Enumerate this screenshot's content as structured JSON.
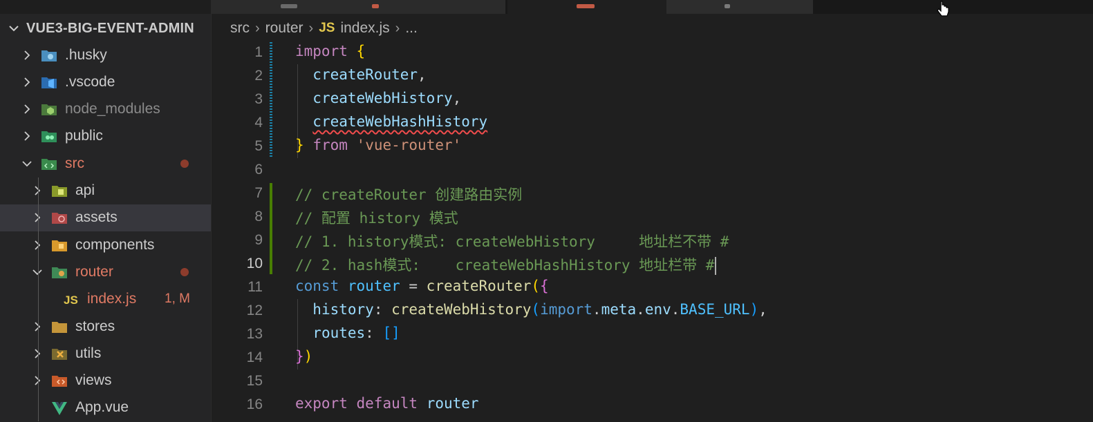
{
  "explorer": {
    "root_label": "VUE3-BIG-EVENT-ADMIN",
    "items": [
      {
        "label": ".husky",
        "icon": "husky-folder-icon",
        "expanded": false,
        "color": "#cccccc"
      },
      {
        "label": ".vscode",
        "icon": "vscode-folder-icon",
        "expanded": false,
        "color": "#cccccc"
      },
      {
        "label": "node_modules",
        "icon": "node-folder-icon",
        "expanded": false,
        "color": "#8b8b8b"
      },
      {
        "label": "public",
        "icon": "public-folder-icon",
        "expanded": false,
        "color": "#cccccc"
      },
      {
        "label": "src",
        "icon": "src-folder-icon",
        "expanded": true,
        "color": "#e07a64",
        "modified": true
      },
      {
        "label": "api",
        "icon": "api-folder-icon",
        "expanded": false,
        "color": "#cccccc"
      },
      {
        "label": "assets",
        "icon": "assets-folder-icon",
        "expanded": false,
        "color": "#cccccc",
        "selected": true
      },
      {
        "label": "components",
        "icon": "components-folder-icon",
        "expanded": false,
        "color": "#cccccc"
      },
      {
        "label": "router",
        "icon": "router-folder-icon",
        "expanded": true,
        "color": "#e07a64",
        "modified": true
      },
      {
        "label": "index.js",
        "icon": "js-file-icon",
        "file": true,
        "color": "#e07a64",
        "status": "1, M"
      },
      {
        "label": "stores",
        "icon": "stores-folder-icon",
        "expanded": false,
        "color": "#cccccc"
      },
      {
        "label": "utils",
        "icon": "utils-folder-icon",
        "expanded": false,
        "color": "#cccccc"
      },
      {
        "label": "views",
        "icon": "views-folder-icon",
        "expanded": false,
        "color": "#cccccc"
      },
      {
        "label": "App.vue",
        "icon": "vue-file-icon",
        "file": true,
        "color": "#cccccc"
      }
    ]
  },
  "breadcrumbs": {
    "parts": [
      "src",
      "router"
    ],
    "file_badge": "JS",
    "file_name": "index.js",
    "ellipsis": "..."
  },
  "editor": {
    "active_line": 10,
    "lines": [
      {
        "n": "1",
        "tokens": [
          [
            "k",
            "import"
          ],
          [
            "p",
            " "
          ],
          [
            "b1",
            "{"
          ]
        ]
      },
      {
        "n": "2",
        "tokens": [
          [
            "p",
            "  "
          ],
          [
            "v",
            "createRouter"
          ],
          [
            "p",
            ","
          ]
        ]
      },
      {
        "n": "3",
        "tokens": [
          [
            "p",
            "  "
          ],
          [
            "v",
            "createWebHistory"
          ],
          [
            "p",
            ","
          ]
        ]
      },
      {
        "n": "4",
        "tokens": [
          [
            "p",
            "  "
          ],
          [
            "squig",
            "createWebHashHistory"
          ]
        ]
      },
      {
        "n": "5",
        "tokens": [
          [
            "b1",
            "}"
          ],
          [
            "p",
            " "
          ],
          [
            "k",
            "from"
          ],
          [
            "p",
            " "
          ],
          [
            "s",
            "'vue-router'"
          ]
        ]
      },
      {
        "n": "6",
        "tokens": []
      },
      {
        "n": "7",
        "tokens": [
          [
            "c",
            "// createRouter 创建路由实例"
          ]
        ]
      },
      {
        "n": "8",
        "tokens": [
          [
            "c",
            "// 配置 history 模式"
          ]
        ]
      },
      {
        "n": "9",
        "tokens": [
          [
            "c",
            "// 1. history模式: createWebHistory     地址栏不带 #"
          ]
        ]
      },
      {
        "n": "10",
        "tokens": [
          [
            "c",
            "// 2. hash模式:    createWebHashHistory 地址栏带 #"
          ],
          [
            "cursor",
            ""
          ]
        ]
      },
      {
        "n": "11",
        "tokens": [
          [
            "kb",
            "const"
          ],
          [
            "p",
            " "
          ],
          [
            "vc",
            "router"
          ],
          [
            "p",
            " = "
          ],
          [
            "f",
            "createRouter"
          ],
          [
            "b1",
            "("
          ],
          [
            "b2",
            "{"
          ]
        ]
      },
      {
        "n": "12",
        "tokens": [
          [
            "p",
            "  "
          ],
          [
            "v",
            "history"
          ],
          [
            "p",
            ": "
          ],
          [
            "f",
            "createWebHistory"
          ],
          [
            "b3",
            "("
          ],
          [
            "kb",
            "import"
          ],
          [
            "p",
            "."
          ],
          [
            "v",
            "meta"
          ],
          [
            "p",
            "."
          ],
          [
            "v",
            "env"
          ],
          [
            "p",
            "."
          ],
          [
            "vc",
            "BASE_URL"
          ],
          [
            "b3",
            ")"
          ],
          [
            "p",
            ","
          ]
        ]
      },
      {
        "n": "13",
        "tokens": [
          [
            "p",
            "  "
          ],
          [
            "v",
            "routes"
          ],
          [
            "p",
            ": "
          ],
          [
            "b3",
            "[]"
          ]
        ]
      },
      {
        "n": "14",
        "tokens": [
          [
            "b2",
            "}"
          ],
          [
            "b1",
            ")"
          ]
        ]
      },
      {
        "n": "15",
        "tokens": []
      },
      {
        "n": "16",
        "tokens": [
          [
            "k",
            "export"
          ],
          [
            "p",
            " "
          ],
          [
            "k",
            "default"
          ],
          [
            "p",
            " "
          ],
          [
            "v",
            "router"
          ]
        ]
      }
    ]
  }
}
